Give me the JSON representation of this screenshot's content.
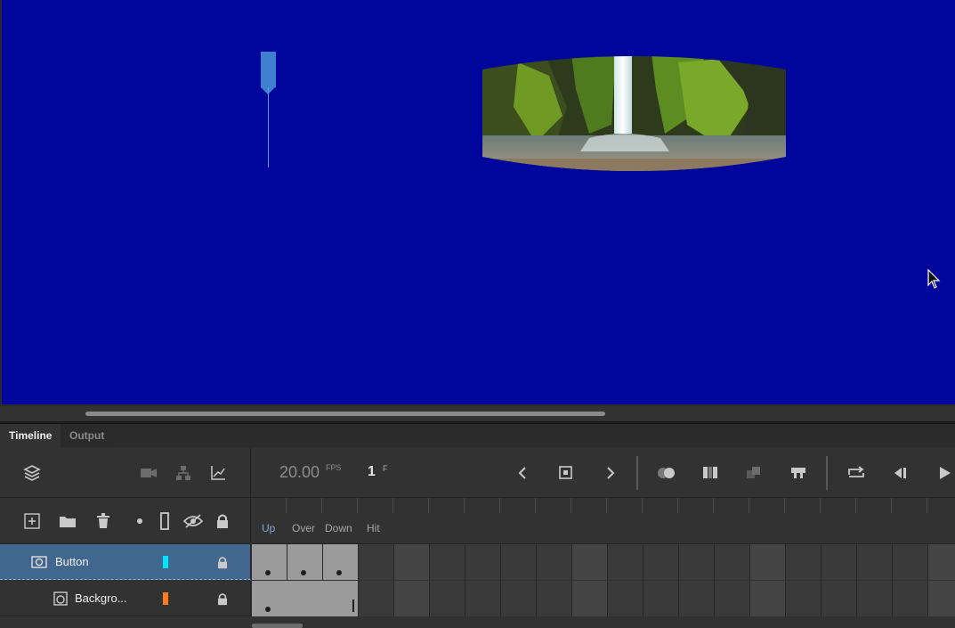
{
  "panel_tabs": {
    "timeline": "Timeline",
    "output": "Output"
  },
  "toolbar": {
    "fps_value": "20.00",
    "fps_unit": "FPS",
    "current_frame": "1",
    "frame_unit": "F"
  },
  "frame_labels": [
    "Up",
    "Over",
    "Down",
    "Hit"
  ],
  "layers": [
    {
      "name": "Button",
      "color": "#00e5ff",
      "selected": true,
      "type": "button"
    },
    {
      "name": "Backgro...",
      "color": "#ff7a1a",
      "selected": false,
      "type": "movieclip"
    }
  ],
  "icons": {
    "layers": "layers-icon",
    "camera": "camera-icon",
    "parenting": "parenting-icon",
    "graph": "graph-icon",
    "add_layer": "add-layer-icon",
    "folder": "folder-icon",
    "delete": "trash-icon",
    "highlight": "dot-icon",
    "outline": "outline-icon",
    "visibility": "eye-off-icon",
    "lock": "lock-icon"
  },
  "colors": {
    "stage_bg": "#00059c",
    "playhead": "#3f7fd0",
    "selected_layer": "#41678e"
  }
}
